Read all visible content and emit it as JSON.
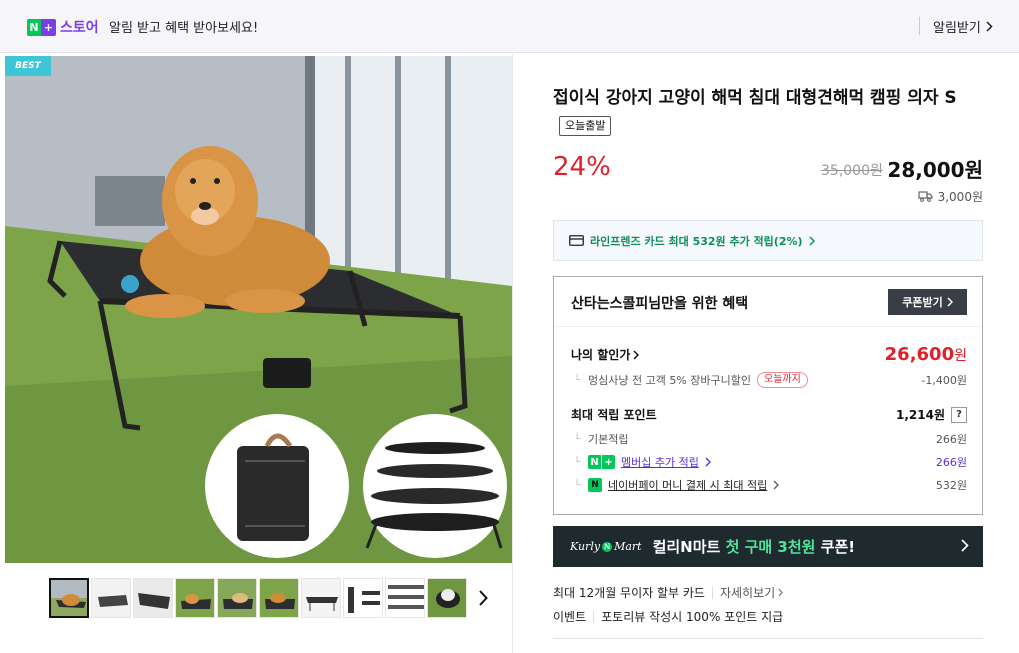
{
  "topbar": {
    "badge_n": "N",
    "badge_plus": "+",
    "store_label": "스토어",
    "message": "알림 받고 혜택 받아보세요!",
    "alarm_label": "알림받기"
  },
  "gallery": {
    "badge": "BEST",
    "thumbnail_count": 10,
    "active_thumbnail": 1
  },
  "product": {
    "title": "접이식 강아지 고양이 해먹 침대 대형견해먹 캠핑 의자 S",
    "tag": "오늘출발",
    "discount": "24%",
    "original_price": "35,000원",
    "sale_price": "28,000원",
    "shipping": "3,000원"
  },
  "card_promo": {
    "text": "라인프렌즈 카드 최대 532원 추가 적립(2%)"
  },
  "benefit": {
    "title": "산타는스콜피님만을 위한 혜택",
    "coupon_button": "쿠폰받기",
    "my_price_label": "나의 할인가",
    "my_price_value": "26,600",
    "my_price_unit": "원",
    "discount_sub_label": "멍심사냥 전 고객 5% 장바구니할인",
    "discount_sub_tag": "오늘까지",
    "discount_sub_value": "-1,400원",
    "points_label": "최대 적립 포인트",
    "points_value": "1,214원",
    "points_help": "?",
    "basic_label": "기본적립",
    "basic_value": "266원",
    "member_label": "멤버십 추가 적립",
    "member_value": "266원",
    "npay_label": "네이버페이 머니 결제 시 최대 적립",
    "npay_value": "532원"
  },
  "kurly": {
    "logo_left": "Kurly",
    "logo_n": "N",
    "logo_right": "Mart",
    "text_a": "컬리N마트",
    "text_b": "첫 구매 3천원",
    "text_c": "쿠폰!"
  },
  "installment": {
    "label": "최대 12개월 무이자 할부 카드",
    "detail": "자세히보기"
  },
  "event": {
    "label": "이벤트",
    "text": "포토리뷰 작성시 100% 포인트 지급"
  },
  "colors": {
    "accent_red": "#e0202b",
    "naver_green": "#03c75a",
    "plus_purple": "#7b3fe4",
    "kurly_bg": "#1f2a2f"
  }
}
